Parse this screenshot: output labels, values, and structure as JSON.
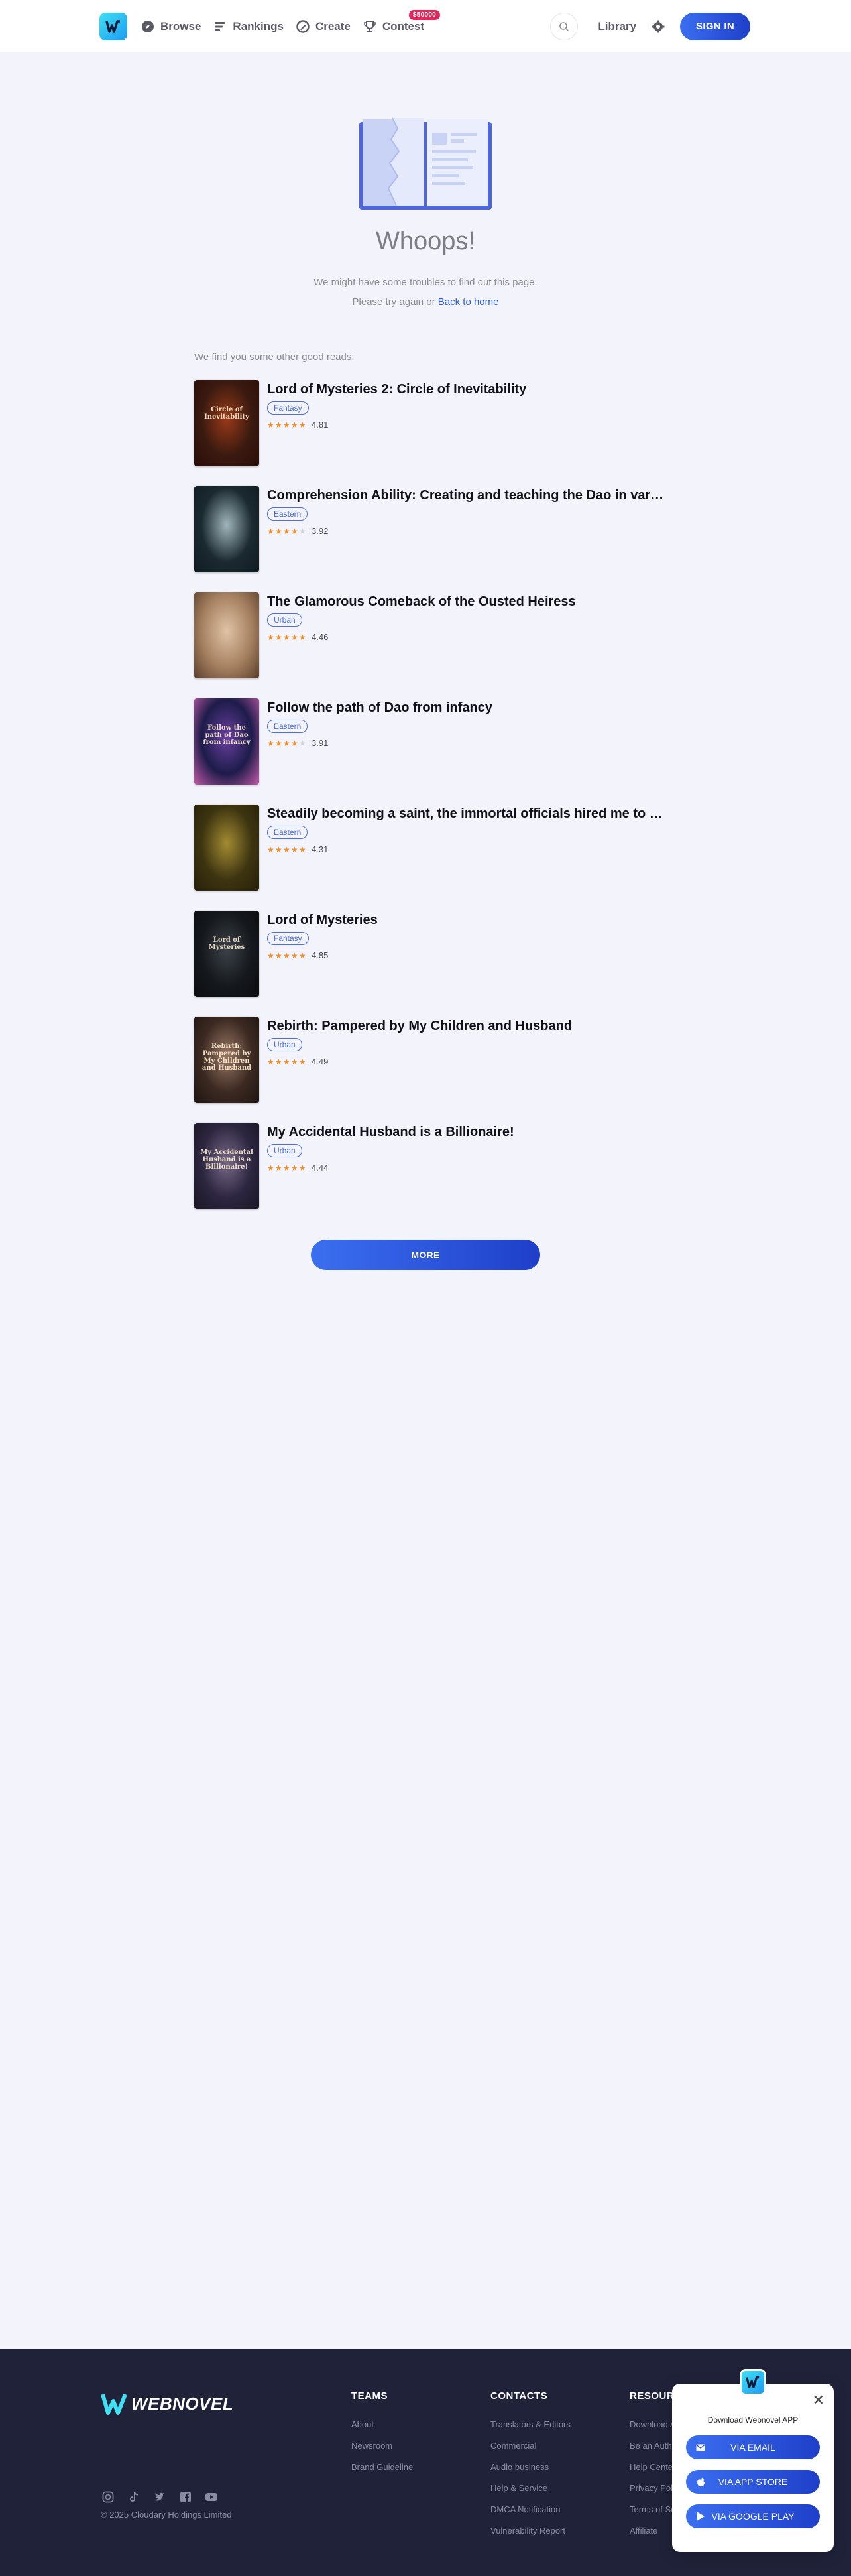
{
  "header": {
    "nav": [
      {
        "label": "Browse",
        "icon": "compass-icon"
      },
      {
        "label": "Rankings",
        "icon": "rankings-icon"
      },
      {
        "label": "Create",
        "icon": "pen-icon"
      },
      {
        "label": "Contest",
        "icon": "trophy-icon",
        "badge": "$50000"
      }
    ],
    "library_label": "Library",
    "signin_label": "SIGN IN"
  },
  "error": {
    "title": "Whoops!",
    "line1": "We might have some troubles to find out this page.",
    "line2_prefix": "Please try again or",
    "back_home": "Back to home"
  },
  "recs": {
    "title": "We find you some other good reads:",
    "books": [
      {
        "title": "Lord of Mysteries 2: Circle of Inevitability",
        "tag": "Fantasy",
        "rating": "4.81",
        "stars": 4.5,
        "cover_text": "Circle of Inevitability",
        "cover_colors": [
          "#3a1a10",
          "#9a3a18",
          "#2a0d08"
        ]
      },
      {
        "title": "Comprehension Ability: Creating and teaching the Dao in various ...",
        "tag": "Eastern",
        "rating": "3.92",
        "stars": 3.5,
        "cover_text": "",
        "cover_colors": [
          "#1b2a30",
          "#9fb6bc",
          "#0f1b22"
        ]
      },
      {
        "title": "The Glamorous Comeback of the Ousted Heiress",
        "tag": "Urban",
        "rating": "4.46",
        "stars": 4.5,
        "cover_text": "",
        "cover_colors": [
          "#a58060",
          "#e0c3a5",
          "#5a3e2b"
        ]
      },
      {
        "title": "Follow the path of Dao from infancy",
        "tag": "Eastern",
        "rating": "3.91",
        "stars": 3.5,
        "cover_text": "Follow the path of Dao from infancy",
        "cover_colors": [
          "#1d1c4a",
          "#6b3fa0",
          "#c45aa8"
        ]
      },
      {
        "title": "Steadily becoming a saint, the immortal officials hired me to be ...",
        "tag": "Eastern",
        "rating": "4.31",
        "stars": 4.5,
        "cover_text": "",
        "cover_colors": [
          "#3d3410",
          "#a38b32",
          "#262008"
        ]
      },
      {
        "title": "Lord of Mysteries",
        "tag": "Fantasy",
        "rating": "4.85",
        "stars": 4.5,
        "cover_text": "Lord of Mysteries",
        "cover_colors": [
          "#15181c",
          "#3b4248",
          "#0b0d10"
        ]
      },
      {
        "title": "Rebirth: Pampered by My Children and Husband",
        "tag": "Urban",
        "rating": "4.49",
        "stars": 4.5,
        "cover_text": "Rebirth: Pampered by My Children and Husband",
        "cover_colors": [
          "#3c2a22",
          "#9b7866",
          "#1e1410"
        ]
      },
      {
        "title": "My Accidental Husband is a Billionaire!",
        "tag": "Urban",
        "rating": "4.44",
        "stars": 4.5,
        "cover_text": "My Accidental Husband is a Billionaire!",
        "cover_colors": [
          "#2c2640",
          "#7a6a88",
          "#1a1524"
        ]
      }
    ],
    "more_label": "MORE"
  },
  "footer": {
    "brand": "WEBNOVEL",
    "copyright": "© 2025 Cloudary Holdings Limited",
    "social": [
      "instagram-icon",
      "tiktok-icon",
      "twitter-icon",
      "facebook-icon",
      "youtube-icon"
    ],
    "columns": [
      {
        "title": "TEAMS",
        "links": [
          "About",
          "Newsroom",
          "Brand Guideline"
        ]
      },
      {
        "title": "CONTACTS",
        "links": [
          "Translators & Editors",
          "Commercial",
          "Audio business",
          "Help & Service",
          "DMCA Notification",
          "Vulnerability Report"
        ]
      },
      {
        "title": "RESOURCES",
        "links": [
          "Download Apps",
          "Be an Author",
          "Help Center",
          "Privacy Policy",
          "Terms of Service",
          "Affiliate"
        ]
      }
    ]
  },
  "popup": {
    "title": "Download Webnovel APP",
    "buttons": [
      {
        "label": "VIA EMAIL",
        "icon": "mail-icon"
      },
      {
        "label": "VIA APP STORE",
        "icon": "apple-icon"
      },
      {
        "label": "VIA GOOGLE PLAY",
        "icon": "google-play-icon"
      }
    ]
  }
}
